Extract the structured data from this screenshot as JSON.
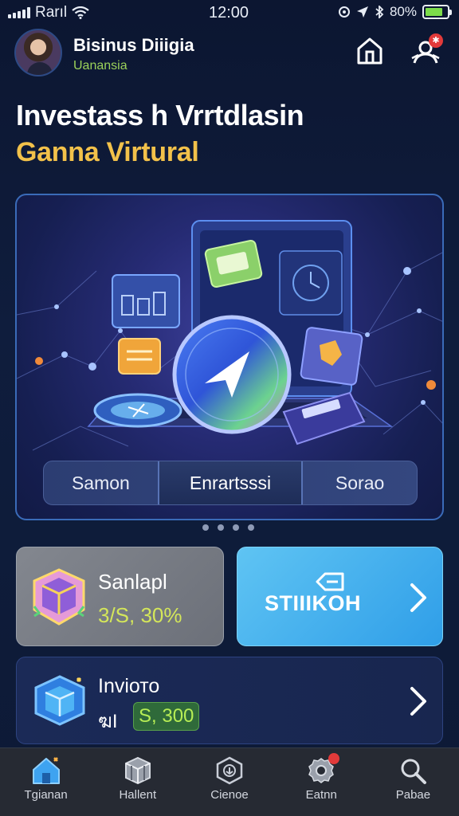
{
  "status_bar": {
    "carrier": "Rarıl",
    "time": "12:00",
    "battery_text": "80%",
    "battery_level": 0.8,
    "battery_color": "#7cdc4a"
  },
  "header": {
    "name": "Bisinus Diiigia",
    "subtitle": "Uanansia",
    "home_icon": "home-icon",
    "user_icon": "user-notification-icon",
    "notification_color": "#e23a3a"
  },
  "hero": {
    "title": "Investass h Vrrtdlasin",
    "subtitle": "Ganna Virtural",
    "accent_color": "#f2c14a"
  },
  "banner": {
    "tabs": [
      {
        "label": "Samon",
        "active": false
      },
      {
        "label": "Enrartsssi",
        "active": true
      },
      {
        "label": "Sorao",
        "active": false
      }
    ],
    "pager_count": 4
  },
  "cards": {
    "asset": {
      "name": "Sanlapl",
      "value": "3/S, 30%",
      "value_color": "#d4e65a"
    },
    "action": {
      "label": "STIIIKOH",
      "color": "#3aa8ec"
    },
    "invite": {
      "name": "Inviото",
      "prefix": "ฆI",
      "amount": "S, 300",
      "amount_color": "#b7ee55"
    }
  },
  "bottom_nav": [
    {
      "label": "Tgianan",
      "icon": "home-icon",
      "active": true
    },
    {
      "label": "Hallent",
      "icon": "box-icon",
      "active": false
    },
    {
      "label": "Cienoe",
      "icon": "shield-icon",
      "active": false
    },
    {
      "label": "Eatnn",
      "icon": "gear-icon",
      "active": false,
      "badge": true
    },
    {
      "label": "Pabae",
      "icon": "search-icon",
      "active": false
    }
  ]
}
